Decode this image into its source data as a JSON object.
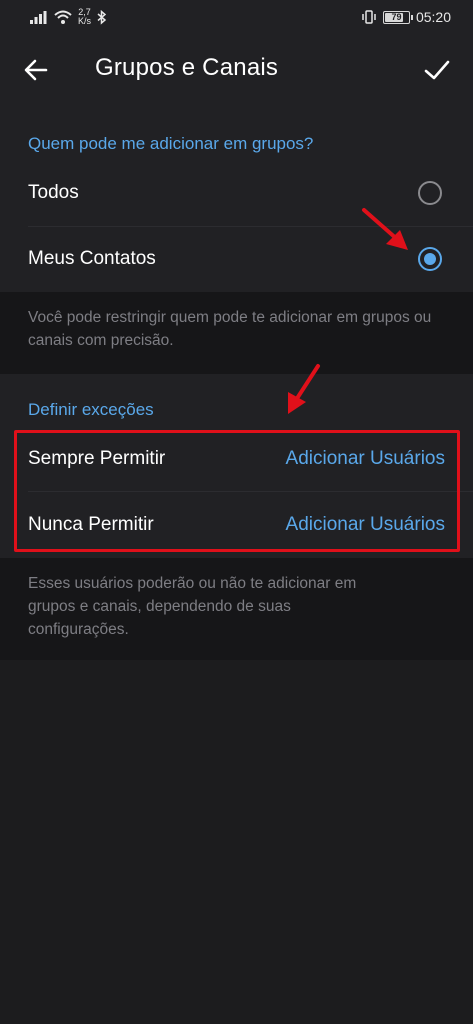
{
  "status_bar": {
    "net_speed_value": "2,7",
    "net_speed_unit": "K/s",
    "battery": "79",
    "battery_level": 0.79,
    "time": "05:20"
  },
  "app_bar": {
    "title": "Grupos e Canais",
    "back_icon": "arrow-left-icon",
    "confirm_icon": "checkmark-icon"
  },
  "who_can_add": {
    "header": "Quem pode me adicionar em grupos?",
    "options": [
      {
        "label": "Todos",
        "selected": false
      },
      {
        "label": "Meus Contatos",
        "selected": true
      }
    ],
    "info": "Você pode restringir quem pode te adicionar em grupos ou canais com precisão."
  },
  "exceptions": {
    "header": "Definir exceções",
    "rows": [
      {
        "label": "Sempre Permitir",
        "action": "Adicionar Usuários"
      },
      {
        "label": "Nunca Permitir",
        "action": "Adicionar Usuários"
      }
    ],
    "info": "Esses usuários poderão ou não te adicionar em grupos e canais, dependendo de suas configurações."
  },
  "colors": {
    "accent": "#5aa8ea",
    "background": "#1c1c1e",
    "surface": "#212124",
    "annotation_red": "#e0101a"
  }
}
